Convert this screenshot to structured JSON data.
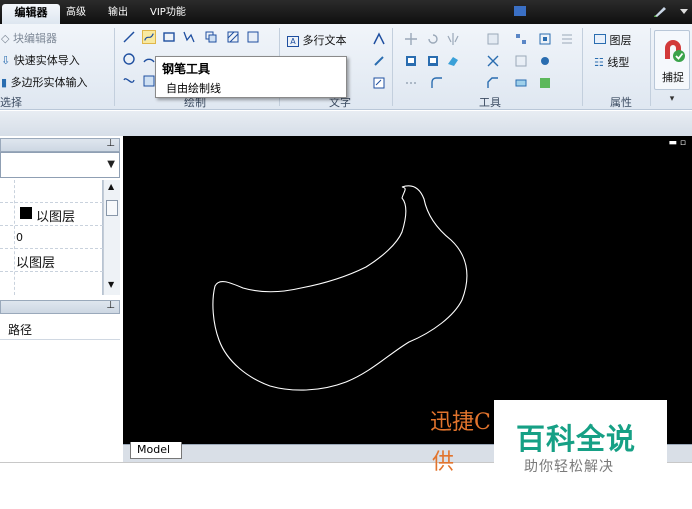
{
  "menubar": {
    "tabs": [
      {
        "label": "编辑器"
      },
      {
        "label": "高级"
      },
      {
        "label": "输出"
      },
      {
        "label": "VIP功能"
      }
    ]
  },
  "ribbon": {
    "select_group": {
      "items": [
        "块编辑器",
        "快速实体导入",
        "多边形实体输入"
      ],
      "label": "选择"
    },
    "draw_group": {
      "label": "绘制"
    },
    "text_group": {
      "multiline_text": "多行文本",
      "label": "文字"
    },
    "tools_group": {
      "label": "工具"
    },
    "property_group": {
      "layer": "图层",
      "linetype": "线型",
      "label": "属性"
    },
    "snap": {
      "label": "捕捉"
    }
  },
  "tooltip": {
    "title": "钢笔工具",
    "description": "自由绘制线"
  },
  "properties_panel": {
    "rows": [
      {
        "value": "以图层",
        "swatch": "#000000"
      },
      {
        "value": "0"
      },
      {
        "value": "以图层"
      }
    ]
  },
  "path_panel": {
    "header": "路径"
  },
  "canvas": {
    "background": "#000000",
    "stroke": "#ffffff",
    "model_tab": "Model"
  },
  "watermark": {
    "orange_text": "迅捷C",
    "orange_text2": "供",
    "brand": "百科全说",
    "slogan": "助你轻松解决"
  },
  "colors": {
    "accent_green": "#16a085",
    "watermark_orange": "#e2742d",
    "menubar": "#1a1a1a"
  }
}
